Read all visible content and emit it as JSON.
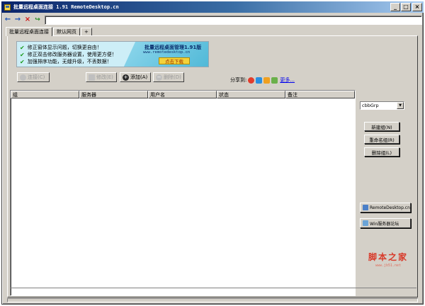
{
  "window": {
    "title": "批量远程桌面连接 1.91 RemoteDesktop.cn",
    "controls": [
      "_",
      "□",
      "×"
    ]
  },
  "nav": {
    "back": "←",
    "forward": "→",
    "stop": "×",
    "go": "↪",
    "address_value": ""
  },
  "tabs": [
    "批量远程桌面连接",
    "默认网页",
    "+"
  ],
  "banner": {
    "features": [
      "修正窗体显示问题，切换更自由！",
      "修正双击修改服务器设置，使用更方便！",
      "加强排序功能，无缝升级，不丢数据！"
    ],
    "promo_title": "批量远程桌面管理1.91版",
    "promo_site": "www.remotedesktop.cn",
    "download_label": "点击下载"
  },
  "toolbar": {
    "connect": "连接(C)",
    "edit": "修改(E)",
    "add": "添加(A)",
    "delete": "删除(D)"
  },
  "share": {
    "label": "分享到:",
    "more": "更多..."
  },
  "table": {
    "columns": [
      "组",
      "服务器",
      "用户名",
      "状态",
      "备注"
    ],
    "rows": []
  },
  "side": {
    "group_select": "cbbGrp",
    "new_group": "新建组(N)",
    "rename_group": "重命名组(R)",
    "delete_group": "删除组(L)",
    "site_link": "RemoteDesktop.cn",
    "forum_link": "Win服务器论坛"
  },
  "watermark": {
    "main": "脚本之家",
    "sub": "www.jb51.net"
  },
  "colors": {
    "titlebar": "#0a246a",
    "face": "#d4d0c8",
    "banner_bg": "#cdeef7",
    "promo": "#4fb8d7",
    "download": "#f4d23a",
    "watermark": "#d83a2a"
  }
}
